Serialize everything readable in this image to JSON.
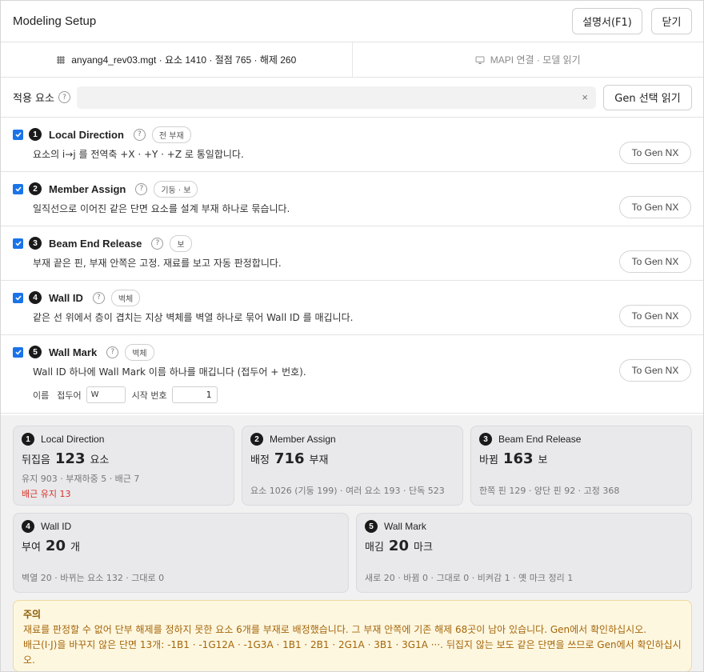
{
  "window": {
    "title": "Modeling Setup",
    "help_label": "설명서(F1)",
    "close_label": "닫기"
  },
  "tabs": [
    {
      "label": "anyang4_rev03.mgt · 요소 1410 · 절점 765 · 해제 260",
      "icon": "grid-icon",
      "active": true
    },
    {
      "label": "MAPI 연결 · 모델 읽기",
      "icon": "monitor-icon",
      "active": false
    }
  ],
  "apply": {
    "label": "적용 요소",
    "input_value": "",
    "clear_icon": "×",
    "read_button": "Gen 선택 읽기"
  },
  "help_glyph": "?",
  "steps": [
    {
      "num": "1",
      "checked": true,
      "title": "Local Direction",
      "tag": "전 부재",
      "desc": "요소의 i→j 를 전역축 +X · +Y · +Z 로 통일합니다.",
      "button": "To Gen NX"
    },
    {
      "num": "2",
      "checked": true,
      "title": "Member Assign",
      "tag": "기둥 · 보",
      "desc": "일직선으로 이어진 같은 단면 요소를 설계 부재 하나로 묶습니다.",
      "button": "To Gen NX"
    },
    {
      "num": "3",
      "checked": true,
      "title": "Beam End Release",
      "tag": "보",
      "desc": "부재 끝은 핀, 부재 안쪽은 고정. 재료를 보고 자동 판정합니다.",
      "button": "To Gen NX"
    },
    {
      "num": "4",
      "checked": true,
      "title": "Wall ID",
      "tag": "벽체",
      "desc": "같은 선 위에서 층이 겹치는 지상 벽체를 벽열 하나로 묶어 Wall ID 를 매깁니다.",
      "button": "To Gen NX"
    },
    {
      "num": "5",
      "checked": true,
      "title": "Wall Mark",
      "tag": "벽체",
      "desc": "Wall ID 하나에 Wall Mark 이름 하나를 매깁니다 (접두어 + 번호).",
      "button": "To Gen NX"
    }
  ],
  "wall_mark_name": {
    "name_label": "이름",
    "prefix_label": "접두어",
    "prefix_value": "W",
    "start_label": "시작 번호",
    "start_value": "1"
  },
  "summary": [
    {
      "num": "1",
      "title": "Local Direction",
      "main_label": "뒤집음",
      "value": "123",
      "unit": "요소",
      "sub": "유지 903 · 부재하중 5 · 배근 7",
      "warn": "배근 유지 13"
    },
    {
      "num": "2",
      "title": "Member Assign",
      "main_label": "배정",
      "value": "716",
      "unit": "부재",
      "sub": "요소 1026 (기둥 199) · 여러 요소 193 · 단독 523"
    },
    {
      "num": "3",
      "title": "Beam End Release",
      "main_label": "바뀜",
      "value": "163",
      "unit": "보",
      "sub": "한쪽 핀 129 · 양단 핀 92 · 고정 368"
    },
    {
      "num": "4",
      "title": "Wall ID",
      "main_label": "부여",
      "value": "20",
      "unit": "개",
      "sub": "벽열 20 · 바뀌는 요소 132 · 그대로 0"
    },
    {
      "num": "5",
      "title": "Wall Mark",
      "main_label": "매김",
      "value": "20",
      "unit": "마크",
      "sub": "새로 20 · 바뀜 0 · 그대로 0 · 비켜감 1 · 옛 마크 정리 1"
    }
  ],
  "notice": {
    "title": "주의",
    "line1": "재료를 판정할 수 없어 단부 해제를 정하지 못한 요소 6개를 부재로 배정했습니다. 그 부재 안쪽에 기존 해제 68곳이 남아 있습니다. Gen에서 확인하십시오.",
    "line2": "배근(I·J)을 바꾸지 않은 단면 13개: -1B1 · -1G12A · -1G3A · 1B1 · 2B1 · 2G1A · 3B1 · 3G1A ···. 뒤집지 않는 보도 같은 단면을 쓰므로 Gen에서 확인하십시오."
  },
  "colors": {
    "accent": "#1a73e8",
    "warning_text": "#d93025",
    "notice_bg": "#fef7e0",
    "notice_text": "#a4660a"
  }
}
